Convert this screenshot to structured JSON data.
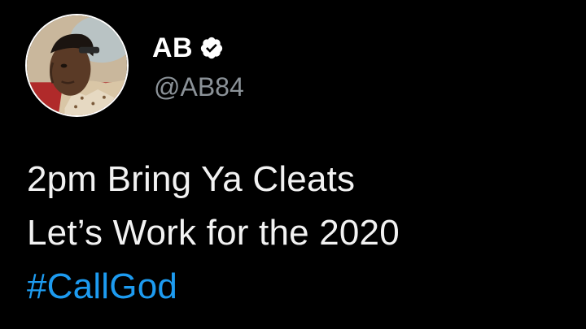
{
  "tweet": {
    "author": {
      "display_name": "AB",
      "handle": "@AB84",
      "verified": true,
      "avatar_icon": "profile-photo"
    },
    "body": {
      "lines": [
        "2pm Bring Ya Cleats",
        "Let’s Work for the 2020"
      ],
      "hashtag": "#CallGod"
    }
  },
  "colors": {
    "background": "#000000",
    "name": "#FFFFFF",
    "handle": "#8B9298",
    "text": "#F2F2F2",
    "link": "#1D9BF0"
  }
}
